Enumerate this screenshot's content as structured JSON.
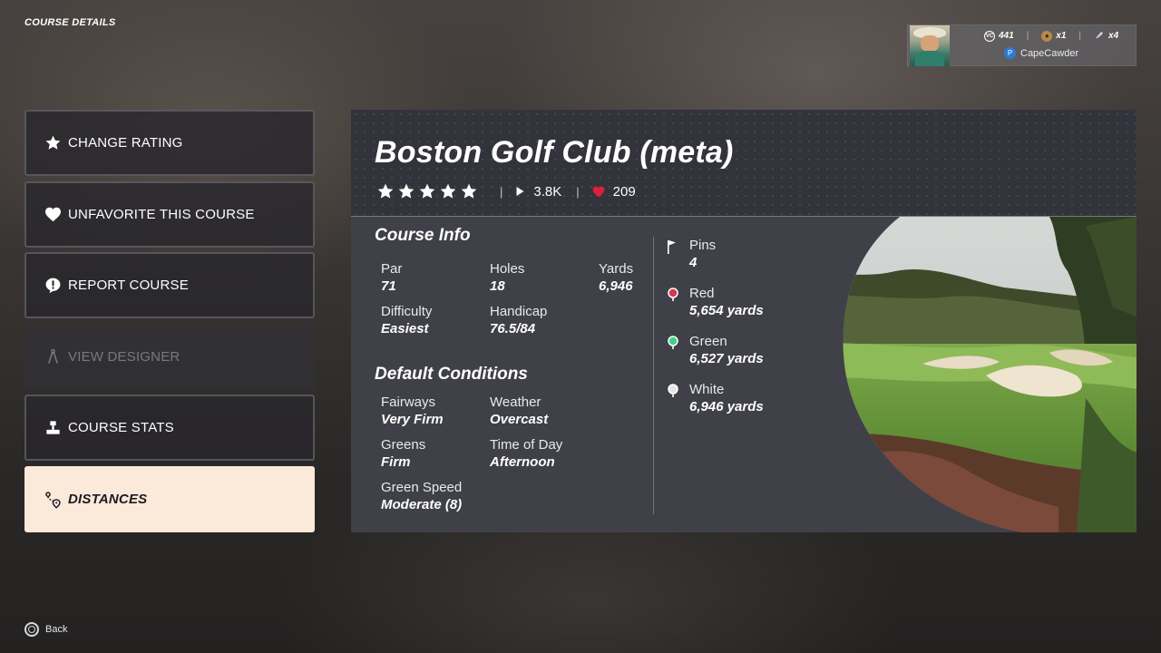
{
  "page_title": "COURSE DETAILS",
  "profile": {
    "username": "CapeCawder",
    "vc": "441",
    "item_one": "x1",
    "item_two": "x4",
    "icons": [
      "avatar",
      "vc-icon",
      "coin-icon",
      "club-icon",
      "playstation-icon"
    ]
  },
  "menu": [
    {
      "label": "CHANGE RATING",
      "icon": "star-icon",
      "state": "normal"
    },
    {
      "label": "UNFAVORITE THIS COURSE",
      "icon": "heart-icon",
      "state": "normal"
    },
    {
      "label": "REPORT COURSE",
      "icon": "alert-icon",
      "state": "normal"
    },
    {
      "label": "VIEW DESIGNER",
      "icon": "compass-icon",
      "state": "disabled"
    },
    {
      "label": "COURSE STATS",
      "icon": "podium-icon",
      "state": "normal"
    },
    {
      "label": "DISTANCES",
      "icon": "route-pin-icon",
      "state": "selected"
    }
  ],
  "course": {
    "name": "Boston Golf Club (meta)",
    "rating_stars": 5,
    "plays": "3.8K",
    "likes": "209"
  },
  "course_info": {
    "title": "Course Info",
    "par_label": "Par",
    "par": "71",
    "holes_label": "Holes",
    "holes": "18",
    "yards_label": "Yards",
    "yards": "6,946",
    "difficulty_label": "Difficulty",
    "difficulty": "Easiest",
    "handicap_label": "Handicap",
    "handicap": "76.5/84"
  },
  "conditions": {
    "title": "Default Conditions",
    "fairways_label": "Fairways",
    "fairways": "Very Firm",
    "weather_label": "Weather",
    "weather": "Overcast",
    "greens_label": "Greens",
    "greens": "Firm",
    "time_label": "Time of Day",
    "time": "Afternoon",
    "green_speed_label": "Green Speed",
    "green_speed": "Moderate (8)"
  },
  "tees": {
    "pins_label": "Pins",
    "pins": "4",
    "list": [
      {
        "label": "Red",
        "yards": "5,654 yards",
        "color": "#d8354a"
      },
      {
        "label": "Green",
        "yards": "6,527 yards",
        "color": "#3fd08a"
      },
      {
        "label": "White",
        "yards": "6,946 yards",
        "color": "#e6e6e6"
      }
    ]
  },
  "back_label": "Back"
}
